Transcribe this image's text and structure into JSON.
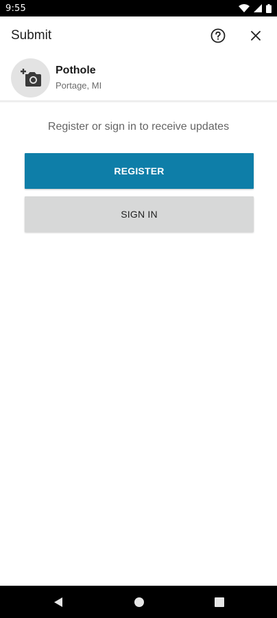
{
  "status_bar": {
    "time": "9:55",
    "icons": [
      "wifi-icon",
      "signal-icon",
      "battery-icon"
    ]
  },
  "app_bar": {
    "title": "Submit",
    "actions": [
      "help-icon",
      "close-icon"
    ]
  },
  "request": {
    "title": "Pothole",
    "location": "Portage, MI",
    "photo_icon": "add-photo-icon"
  },
  "auth": {
    "prompt": "Register or sign in to receive updates",
    "register_label": "REGISTER",
    "signin_label": "SIGN IN"
  },
  "nav_bar": {
    "buttons": [
      "back-icon",
      "home-icon",
      "recents-icon"
    ]
  },
  "colors": {
    "primary": "#0e7ea8",
    "secondary_button": "#d7d8d8",
    "photo_circle": "#e3e3e3"
  }
}
